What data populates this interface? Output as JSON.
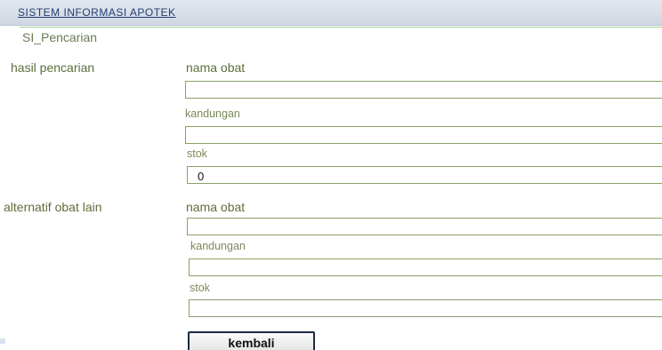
{
  "header": {
    "title": "SISTEM INFORMASI APOTEK"
  },
  "page": {
    "subtitle": "SI_Pencarian"
  },
  "hasil_pencarian": {
    "section_label": "hasil pencarian",
    "nama_obat_label": "nama obat",
    "nama_obat_value": "",
    "kandungan_label": "kandungan",
    "kandungan_value": "",
    "stok_label": "stok",
    "stok_value": "0"
  },
  "alternatif_obat": {
    "section_label": "alternatif obat lain",
    "nama_obat_label": "nama obat",
    "nama_obat_value": "",
    "kandungan_label": "kandungan",
    "kandungan_value": "",
    "stok_label": "stok",
    "stok_value": ""
  },
  "actions": {
    "kembali_label": "kembali"
  },
  "colors": {
    "header_bg": "#d6dde7",
    "label_text": "#5c6e3c",
    "input_border": "#8aa06a",
    "title_link": "#1f3f73"
  }
}
